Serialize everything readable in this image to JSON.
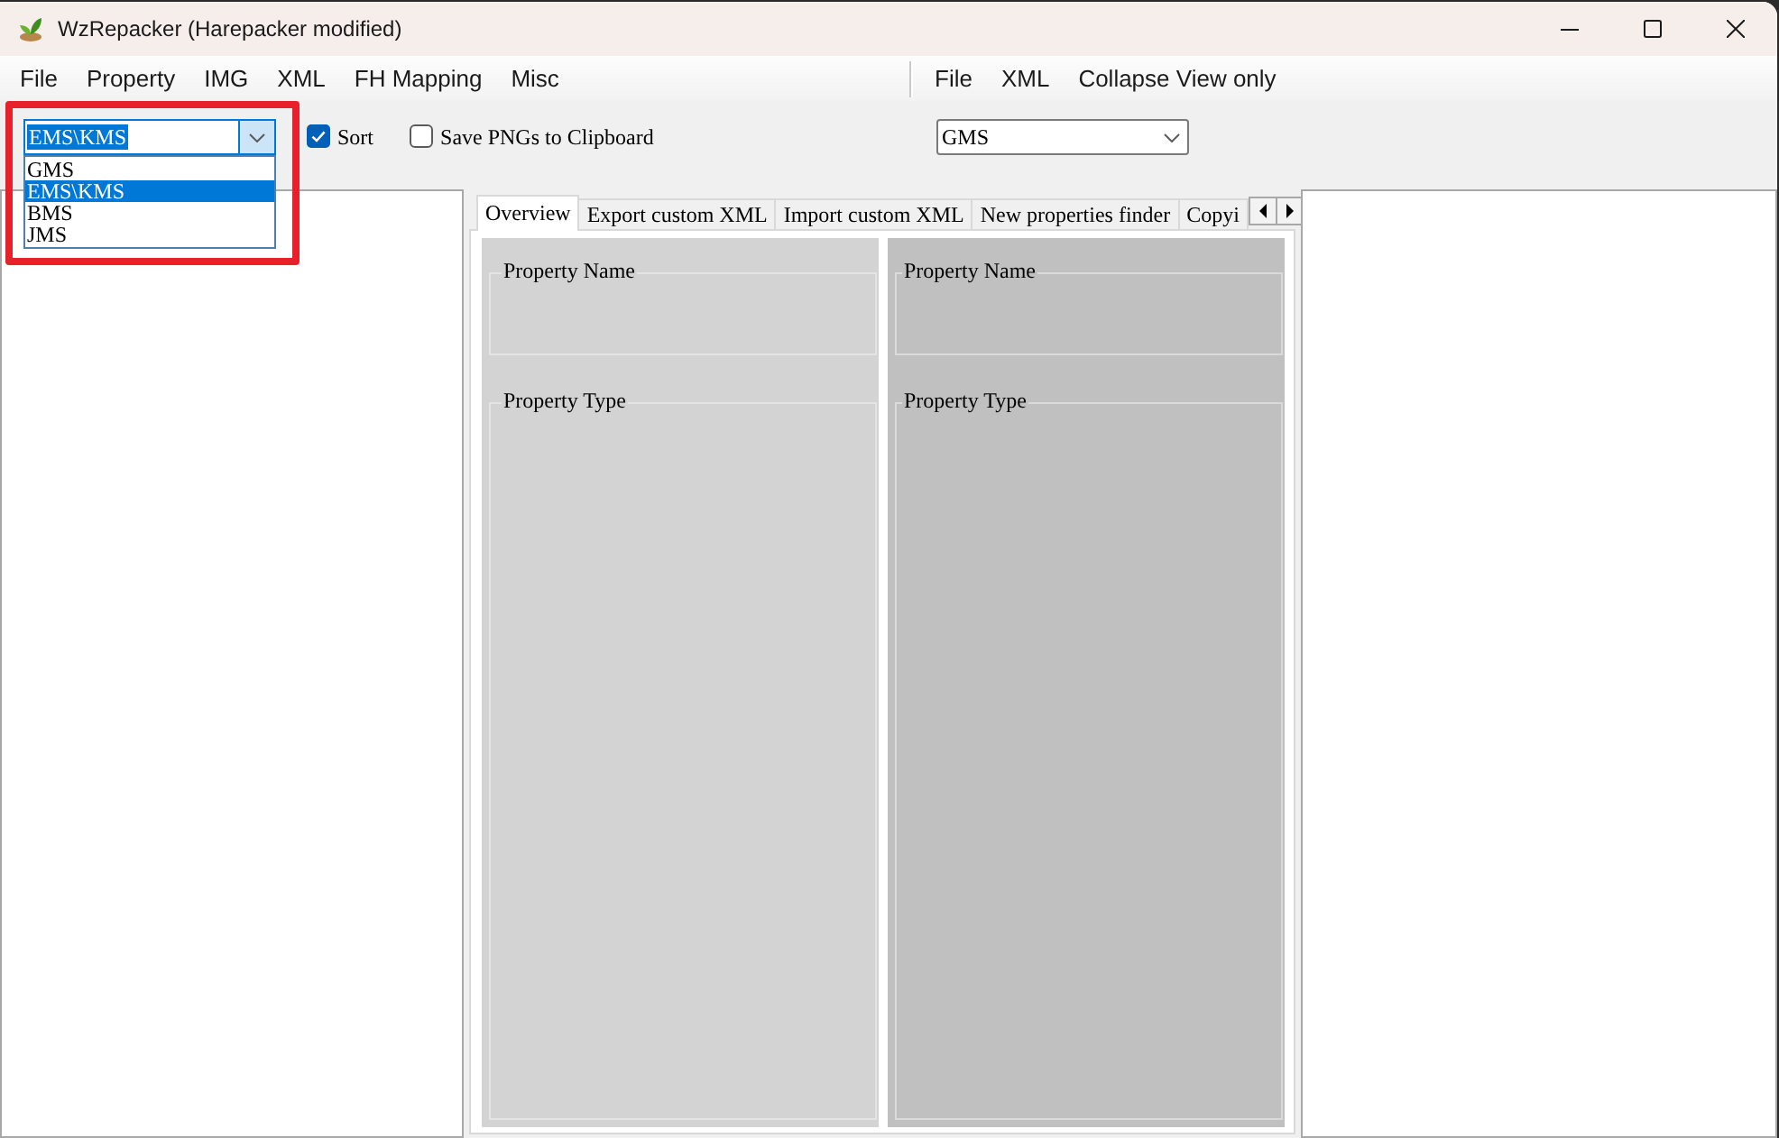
{
  "window": {
    "title": "WzRepacker (Harepacker modified)"
  },
  "menu": [
    {
      "label": "File"
    },
    {
      "label": "Property"
    },
    {
      "label": "IMG"
    },
    {
      "label": "XML"
    },
    {
      "label": "FH Mapping"
    },
    {
      "label": "Misc"
    }
  ],
  "secondary_menu": [
    {
      "label": "File"
    },
    {
      "label": "XML"
    },
    {
      "label": "Collapse View only"
    }
  ],
  "region_dropdown": {
    "value": "EMS\\KMS",
    "expanded": true,
    "highlighted": true,
    "options": [
      {
        "label": "GMS",
        "selected": false
      },
      {
        "label": "EMS\\KMS",
        "selected": true
      },
      {
        "label": "BMS",
        "selected": false
      },
      {
        "label": "JMS",
        "selected": false
      }
    ]
  },
  "checkboxes": [
    {
      "label": "Sort",
      "checked": true
    },
    {
      "label": "Save PNGs to Clipboard",
      "checked": false
    }
  ],
  "secondary_dropdown": {
    "value": "GMS"
  },
  "tabs": [
    {
      "label": "Overview",
      "selected": true
    },
    {
      "label": "Export custom XML",
      "selected": false
    },
    {
      "label": "Import custom XML",
      "selected": false
    },
    {
      "label": "New properties finder",
      "selected": false
    },
    {
      "label": "Copyi",
      "selected": false
    }
  ],
  "panels": [
    {
      "groups": [
        {
          "label": "Property Name"
        },
        {
          "label": "Property Type"
        }
      ]
    },
    {
      "groups": [
        {
          "label": "Property Name"
        },
        {
          "label": "Property Type"
        }
      ]
    }
  ]
}
